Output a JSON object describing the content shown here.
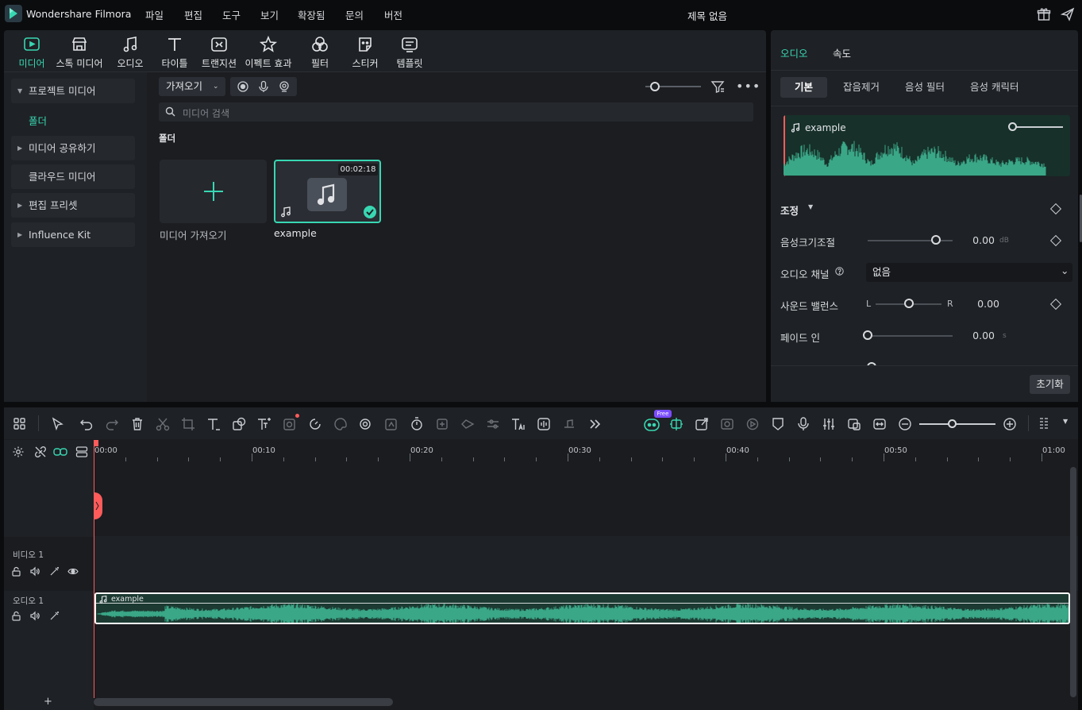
{
  "app": {
    "title": "Wondershare Filmora",
    "project_title": "제목 없음"
  },
  "menu": [
    "파일",
    "편집",
    "도구",
    "보기",
    "확장됨",
    "문의",
    "버전"
  ],
  "tool_tabs": [
    {
      "label": "미디어",
      "icon": "media-icon",
      "active": true
    },
    {
      "label": "스톡 미디어",
      "icon": "stock-media-icon"
    },
    {
      "label": "오디오",
      "icon": "music-note-icon"
    },
    {
      "label": "타이틀",
      "icon": "title-t-icon"
    },
    {
      "label": "트랜지션",
      "icon": "transition-icon"
    },
    {
      "label": "이펙트 효과",
      "icon": "effects-icon"
    },
    {
      "label": "필터",
      "icon": "filter-icon"
    },
    {
      "label": "스티커",
      "icon": "sticker-icon"
    },
    {
      "label": "템플릿",
      "icon": "template-icon"
    }
  ],
  "sidebar": {
    "items": [
      {
        "label": "프로젝트 미디어",
        "expanded": true
      },
      {
        "label": "폴더",
        "selected": true
      },
      {
        "label": "미디어 공유하기",
        "expanded": false
      },
      {
        "label": "클라우드 미디어"
      },
      {
        "label": "편집 프리셋",
        "expanded": false
      },
      {
        "label": "Influence Kit",
        "expanded": false
      }
    ]
  },
  "media": {
    "import_label": "가져오기",
    "search_placeholder": "미디어 검색",
    "folder_label": "폴더",
    "import_tile_label": "미디어 가져오기",
    "clip": {
      "name": "example",
      "duration": "00:02:18"
    }
  },
  "props": {
    "tabs": [
      {
        "label": "오디오",
        "active": true
      },
      {
        "label": "속도"
      }
    ],
    "subtabs": [
      {
        "label": "기본",
        "active": true
      },
      {
        "label": "잡음제거"
      },
      {
        "label": "음성 필터"
      },
      {
        "label": "음성 캐릭터"
      }
    ],
    "preview_name": "example",
    "section": "조정",
    "volume": {
      "label": "음성크기조절",
      "value": "0.00",
      "unit": "dB",
      "level": 0.8
    },
    "channel": {
      "label": "오디오 채널",
      "value": "없음"
    },
    "balance": {
      "label": "사운드 밸런스",
      "left": "L",
      "right": "R",
      "value": "0.00",
      "level": 0.5
    },
    "fade_in": {
      "label": "페이드 인",
      "value": "0.00",
      "unit": "s",
      "level": 0
    },
    "reset_label": "초기화"
  },
  "timeline": {
    "free_badge": "Free",
    "ticks": [
      "00:00",
      "00:10",
      "00:20",
      "00:30",
      "00:40",
      "00:50",
      "01:00"
    ],
    "tracks": [
      {
        "label": "비디오 1"
      },
      {
        "label": "오디오 1"
      }
    ],
    "audio_clip": "example",
    "add_label": "+"
  },
  "colors": {
    "accent": "#38d7b2",
    "wave": "#3aa787",
    "playhead": "#ff5b5b",
    "panel": "#1e2125"
  }
}
